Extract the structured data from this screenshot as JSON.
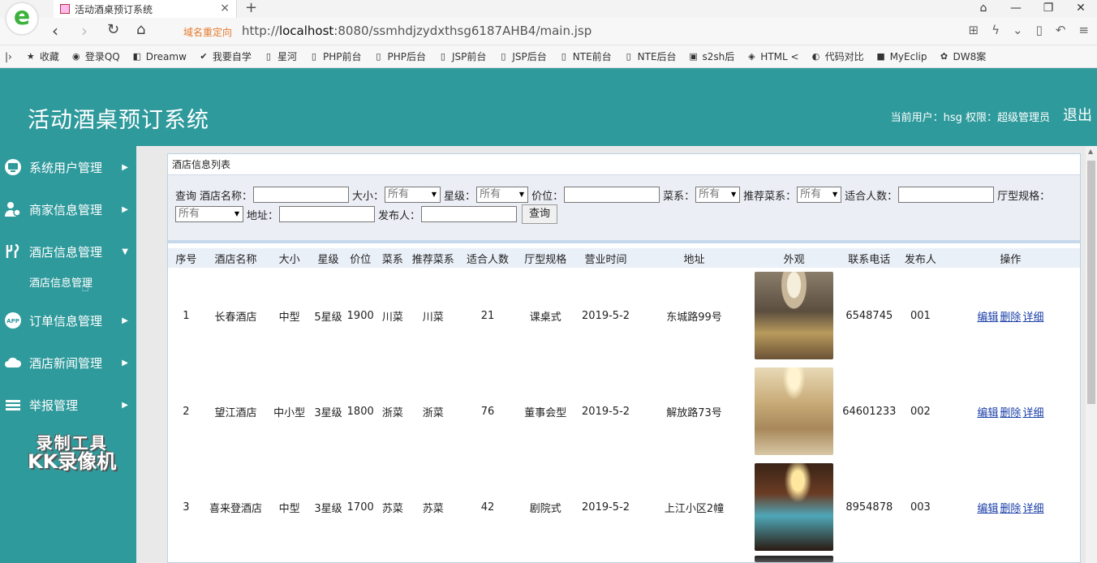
{
  "browser": {
    "tab_title": "活动酒桌预订系统",
    "tab_close": "×",
    "new_tab": "+",
    "logo_letter": "e",
    "redirect_label": "域名重定向",
    "url_prefix": "http://",
    "url_host": "localhost",
    "url_rest": ":8080/ssmhdjzydxthsg6187AHB4/main.jsp",
    "window_controls": [
      "⌂",
      "—",
      "❐",
      "✕"
    ],
    "bookmarks": [
      {
        "icon": "star-icon",
        "glyph": "★",
        "label": "收藏"
      },
      {
        "icon": "qq-icon",
        "glyph": "◉",
        "label": "登录QQ"
      },
      {
        "icon": "dreamweaver-icon",
        "glyph": "◧",
        "label": "Dreamw"
      },
      {
        "icon": "checkmark-icon",
        "glyph": "✔",
        "label": "我要自学"
      },
      {
        "icon": "page-icon",
        "glyph": "▯",
        "label": "星河"
      },
      {
        "icon": "page-icon",
        "glyph": "▯",
        "label": "PHP前台"
      },
      {
        "icon": "page-icon",
        "glyph": "▯",
        "label": "PHP后台"
      },
      {
        "icon": "page-icon",
        "glyph": "▯",
        "label": "JSP前台"
      },
      {
        "icon": "page-icon",
        "glyph": "▯",
        "label": "JSP后台"
      },
      {
        "icon": "page-icon",
        "glyph": "▯",
        "label": "NTE前台"
      },
      {
        "icon": "page-icon",
        "glyph": "▯",
        "label": "NTE后台"
      },
      {
        "icon": "image-icon",
        "glyph": "▣",
        "label": "s2sh后"
      },
      {
        "icon": "html-icon",
        "glyph": "◈",
        "label": "HTML <"
      },
      {
        "icon": "compare-icon",
        "glyph": "◐",
        "label": "代码对比"
      },
      {
        "icon": "eclipse-icon",
        "glyph": "■",
        "label": "MyEclip"
      },
      {
        "icon": "paw-icon",
        "glyph": "✿",
        "label": "DW8案"
      }
    ]
  },
  "header": {
    "title": "活动酒桌预订系统",
    "user_info": "当前用户：hsg  权限：超级管理员",
    "logout": "退出"
  },
  "sidebar": {
    "items": [
      {
        "label": "系统用户管理",
        "icon": "monitor-icon",
        "arrow": "▶"
      },
      {
        "label": "商家信息管理",
        "icon": "users-icon",
        "arrow": "▶"
      },
      {
        "label": "酒店信息管理",
        "icon": "fork-icon",
        "arrow": "▼"
      },
      {
        "label": "订单信息管理",
        "icon": "app-icon",
        "arrow": "▶"
      },
      {
        "label": "酒店新闻管理",
        "icon": "cloud-icon",
        "arrow": "▶"
      },
      {
        "label": "举报管理",
        "icon": "list-icon",
        "arrow": "▶"
      }
    ],
    "submenu_item": "酒店信息管理",
    "watermark_line1": "录制工具",
    "watermark_line2": "KK录像机"
  },
  "panel": {
    "title": "酒店信息列表",
    "search": {
      "query_label": "查询",
      "name_label": "酒店名称：",
      "size_label": "大小：",
      "size_value": "所有",
      "star_label": "星级：",
      "star_value": "所有",
      "price_label": "价位：",
      "cuisine_label": "菜系：",
      "cuisine_value": "所有",
      "recommended_label": "推荐菜系：",
      "recommended_value": "所有",
      "capacity_label": "适合人数：",
      "hall_label": "厅型规格：",
      "hall_value": "所有",
      "address_label": "地址：",
      "publisher_label": "发布人：",
      "search_button": "查询"
    },
    "table": {
      "headers": [
        "序号",
        "酒店名称",
        "大小",
        "星级",
        "价位",
        "菜系",
        "推荐菜系",
        "适合人数",
        "厅型规格",
        "营业时间",
        "地址",
        "外观",
        "联系电话",
        "发布人",
        "操作"
      ],
      "rows": [
        {
          "no": "1",
          "name": "长春酒店",
          "size": "中型",
          "star": "5星级",
          "price": "1900",
          "cuisine": "川菜",
          "recommended": "川菜",
          "capacity": "21",
          "hall": "课桌式",
          "time": "2019-5-2",
          "address": "东城路99号",
          "phone": "6548745",
          "publisher": "001"
        },
        {
          "no": "2",
          "name": "望江酒店",
          "size": "中小型",
          "star": "3星级",
          "price": "1800",
          "cuisine": "浙菜",
          "recommended": "浙菜",
          "capacity": "76",
          "hall": "董事会型",
          "time": "2019-5-2",
          "address": "解放路73号",
          "phone": "64601233",
          "publisher": "002"
        },
        {
          "no": "3",
          "name": "喜来登酒店",
          "size": "中型",
          "star": "3星级",
          "price": "1700",
          "cuisine": "苏菜",
          "recommended": "苏菜",
          "capacity": "42",
          "hall": "剧院式",
          "time": "2019-5-2",
          "address": "上江小区2幢",
          "phone": "8954878",
          "publisher": "003"
        }
      ],
      "actions": {
        "edit": "编辑",
        "delete": "删除",
        "detail": "详细"
      }
    }
  }
}
